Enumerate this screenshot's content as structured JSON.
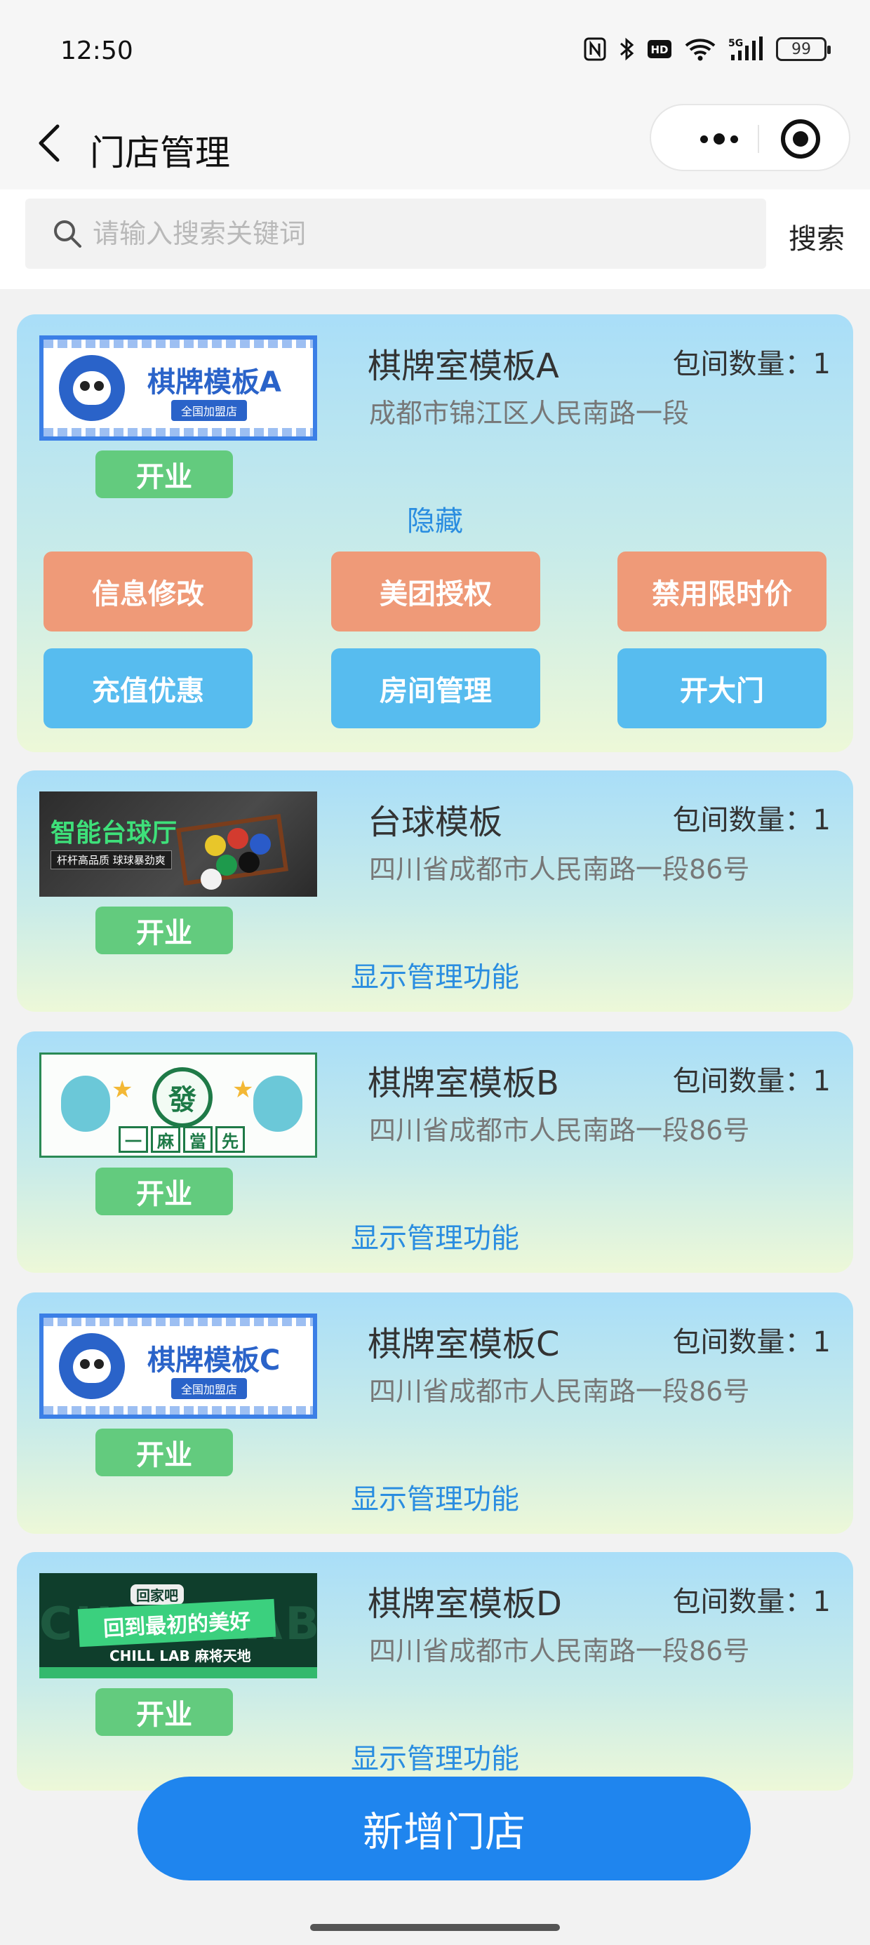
{
  "status_bar": {
    "time": "12:50",
    "battery": "99",
    "icons": [
      "nfc-icon",
      "bluetooth-icon",
      "hd-icon",
      "wifi-icon",
      "5g-signal-icon",
      "battery-icon"
    ]
  },
  "nav": {
    "title": "门店管理"
  },
  "search": {
    "placeholder": "请输入搜索关键词",
    "value": "",
    "button_label": "搜索"
  },
  "stores": [
    {
      "name": "棋牌室模板A",
      "room_count_label": "包间数量：",
      "room_count": "1",
      "address": "成都市锦江区人民南路一段",
      "status": "开业",
      "toggle_label": "隐藏",
      "expanded": true,
      "thumb": {
        "title": "棋牌模板A",
        "subtitle": "全国加盟店"
      },
      "actions": [
        {
          "label": "信息修改",
          "color": "#ef9a78"
        },
        {
          "label": "美团授权",
          "color": "#ef9a78"
        },
        {
          "label": "禁用限时价",
          "color": "#ef9a78"
        },
        {
          "label": "充值优惠",
          "color": "#57bcef"
        },
        {
          "label": "房间管理",
          "color": "#57bcef"
        },
        {
          "label": "开大门",
          "color": "#57bcef"
        }
      ]
    },
    {
      "name": "台球模板",
      "room_count_label": "包间数量：",
      "room_count": "1",
      "address": "四川省成都市人民南路一段86号",
      "status": "开业",
      "toggle_label": "显示管理功能",
      "expanded": false,
      "thumb": {
        "title": "智能台球厅",
        "subtitle": "杆杆高品质  球球暴劲爽"
      }
    },
    {
      "name": "棋牌室模板B",
      "room_count_label": "包间数量：",
      "room_count": "1",
      "address": "四川省成都市人民南路一段86号",
      "status": "开业",
      "toggle_label": "显示管理功能",
      "expanded": false,
      "thumb": {
        "title": "發",
        "tiles": [
          "一",
          "麻",
          "當",
          "先"
        ]
      }
    },
    {
      "name": "棋牌室模板C",
      "room_count_label": "包间数量：",
      "room_count": "1",
      "address": "四川省成都市人民南路一段86号",
      "status": "开业",
      "toggle_label": "显示管理功能",
      "expanded": false,
      "thumb": {
        "title": "棋牌模板C",
        "subtitle": "全国加盟店"
      }
    },
    {
      "name": "棋牌室模板D",
      "room_count_label": "包间数量：",
      "room_count": "1",
      "address": "四川省成都市人民南路一段86号",
      "status": "开业",
      "toggle_label": "显示管理功能",
      "expanded": false,
      "thumb": {
        "title": "回到最初的美好",
        "small": "回家吧",
        "lab": "CHILL LAB 麻将天地",
        "bg": "CHILL LAB"
      }
    }
  ],
  "add_button_label": "新增门店",
  "colors": {
    "accent_blue": "#1f85ee",
    "open_green": "#63cb7e",
    "link_blue": "#2a8de0"
  }
}
